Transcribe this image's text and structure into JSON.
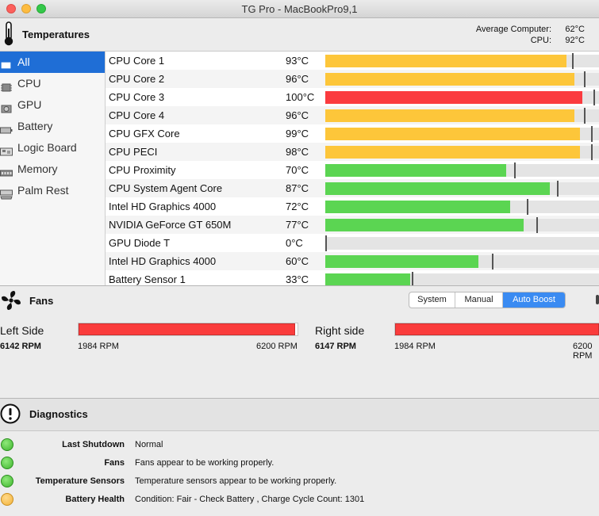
{
  "window": {
    "title": "TG Pro - MacBookPro9,1"
  },
  "temperatures": {
    "title": "Temperatures",
    "average_label": "Average Computer:",
    "average_value": "62°C",
    "cpu_label": "CPU:",
    "cpu_value": "92°C"
  },
  "sidebar": {
    "items": [
      {
        "label": "All",
        "icon": "monitor-icon",
        "selected": true
      },
      {
        "label": "CPU",
        "icon": "chip-icon"
      },
      {
        "label": "GPU",
        "icon": "gpu-icon"
      },
      {
        "label": "Battery",
        "icon": "battery-icon"
      },
      {
        "label": "Logic Board",
        "icon": "logic-board-icon"
      },
      {
        "label": "Memory",
        "icon": "memory-icon"
      },
      {
        "label": "Palm Rest",
        "icon": "palm-rest-icon"
      }
    ]
  },
  "sensors": [
    {
      "name": "CPU Core 1",
      "temp": "93°C",
      "level": 0.88,
      "max": 0.9,
      "status": "warning"
    },
    {
      "name": "CPU Core 2",
      "temp": "96°C",
      "level": 0.91,
      "max": 0.945,
      "status": "warning"
    },
    {
      "name": "CPU Core 3",
      "temp": "100°C",
      "level": 0.94,
      "max": 0.98,
      "status": "critical"
    },
    {
      "name": "CPU Core 4",
      "temp": "96°C",
      "level": 0.91,
      "max": 0.945,
      "status": "warning"
    },
    {
      "name": "CPU GFX Core",
      "temp": "99°C",
      "level": 0.93,
      "max": 0.97,
      "status": "warning"
    },
    {
      "name": "CPU PECI",
      "temp": "98°C",
      "level": 0.93,
      "max": 0.97,
      "status": "warning"
    },
    {
      "name": "CPU Proximity",
      "temp": "70°C",
      "level": 0.66,
      "max": 0.69,
      "status": "normal"
    },
    {
      "name": "CPU System Agent Core",
      "temp": "87°C",
      "level": 0.82,
      "max": 0.845,
      "status": "normal"
    },
    {
      "name": "Intel HD Graphics 4000",
      "temp": "72°C",
      "level": 0.675,
      "max": 0.735,
      "status": "normal"
    },
    {
      "name": "NVIDIA GeForce GT 650M",
      "temp": "77°C",
      "level": 0.725,
      "max": 0.77,
      "status": "normal"
    },
    {
      "name": "GPU Diode T",
      "temp": "0°C",
      "level": 0.0,
      "max": 0.0,
      "status": "normal"
    },
    {
      "name": "Intel HD Graphics 4000",
      "temp": "60°C",
      "level": 0.56,
      "max": 0.61,
      "status": "normal"
    },
    {
      "name": "Battery Sensor 1",
      "temp": "33°C",
      "level": 0.31,
      "max": 0.315,
      "status": "normal"
    }
  ],
  "colors": {
    "warning": "#fdc63a",
    "critical": "#fb3b3f",
    "normal": "#5bd552"
  },
  "fans": {
    "title": "Fans",
    "modes": [
      "System",
      "Manual",
      "Auto Boost"
    ],
    "active_mode": "Auto Boost",
    "left": {
      "label": "Left Side",
      "rpm": "6142 RPM",
      "min": "1984 RPM",
      "max": "6200 RPM",
      "level": 0.99
    },
    "right": {
      "label": "Right side",
      "rpm": "6147 RPM",
      "min": "1984 RPM",
      "max": "6200 RPM",
      "level": 0.99
    }
  },
  "diagnostics": {
    "title": "Diagnostics",
    "items": [
      {
        "label": "Last Shutdown",
        "value": "Normal",
        "status": "green"
      },
      {
        "label": "Fans",
        "value": "Fans appear to be working properly.",
        "status": "green"
      },
      {
        "label": "Temperature Sensors",
        "value": "Temperature sensors appear to be working properly.",
        "status": "green"
      },
      {
        "label": "Battery Health",
        "value": "Condition: Fair - Check Battery , Charge Cycle Count: 1301",
        "status": "yellow"
      }
    ]
  }
}
